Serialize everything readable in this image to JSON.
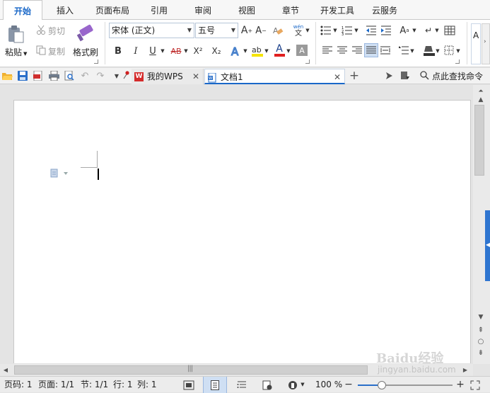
{
  "menu": {
    "tabs": [
      {
        "label": "开始",
        "active": true
      },
      {
        "label": "插入"
      },
      {
        "label": "页面布局"
      },
      {
        "label": "引用"
      },
      {
        "label": "审阅"
      },
      {
        "label": "视图"
      },
      {
        "label": "章节"
      },
      {
        "label": "开发工具"
      },
      {
        "label": "云服务"
      }
    ]
  },
  "ribbon": {
    "paste_label": "粘贴",
    "cut_label": "剪切",
    "copy_label": "复制",
    "format_painter_label": "格式刷",
    "font_name": "宋体 (正文)",
    "font_size": "五号",
    "style_preview": "A",
    "pinyin_glyph": "wén",
    "bold": "B",
    "italic": "I",
    "underline": "U",
    "strike": "AB",
    "superscript": "X²",
    "subscript": "X₂",
    "font_color_glyph": "A"
  },
  "quick_bar": {
    "tabs": [
      {
        "label": "我的WPS"
      },
      {
        "label": "文档1",
        "active": true
      }
    ],
    "new_tab": "+",
    "search_label": "点此查找命令"
  },
  "status": {
    "page_num": "页码: 1",
    "page": "页面: 1/1",
    "section": "节: 1/1",
    "line": "行: 1",
    "col": "列: 1",
    "zoom": "100 %",
    "zoom_level_percent": 100
  },
  "watermark": {
    "brand": "Baidu经验",
    "url": "jingyan.baidu.com"
  },
  "colors": {
    "accent": "#1a68c8",
    "active_tab_text": "#1a68c8",
    "highlighter": "#f5e400",
    "font_color": "#e02020",
    "side_handle": "#2f75d0"
  }
}
